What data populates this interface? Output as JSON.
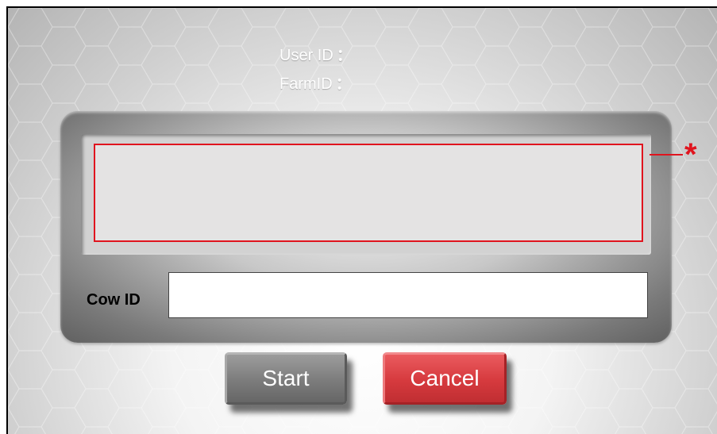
{
  "header": {
    "user_id_label": "User ID",
    "farm_id_label": "FarmID",
    "separator": "："
  },
  "display": {
    "required_marker": "*"
  },
  "cow_id": {
    "label": "Cow ID",
    "value": ""
  },
  "buttons": {
    "start_label": "Start",
    "cancel_label": "Cancel"
  },
  "colors": {
    "required_red": "#e0141e",
    "start_button": "#7c7c7c",
    "cancel_button": "#d63a3e"
  }
}
